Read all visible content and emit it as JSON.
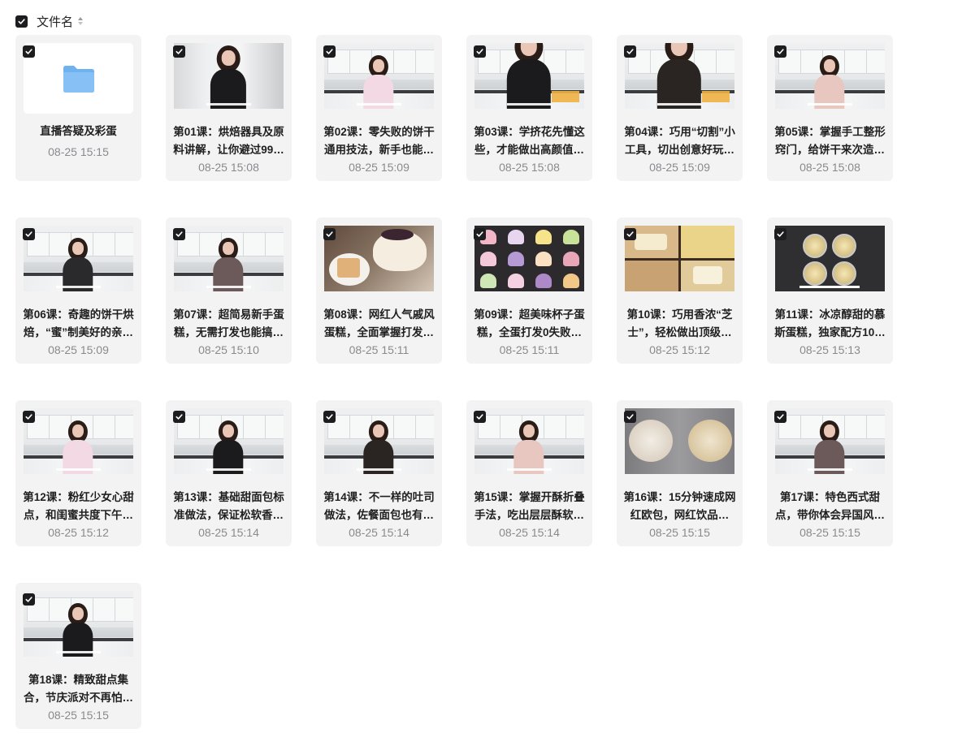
{
  "header": {
    "label": "文件名",
    "sort_icon": "sort-updown-icon",
    "check_icon": "check-icon"
  },
  "colors": {
    "checkbox": "#1d1d1f",
    "card_bg": "#f3f3f4",
    "time": "#8a8a8e",
    "folder": "#6fb2f0"
  },
  "items": [
    {
      "type": "folder",
      "title": "直播答疑及彩蛋",
      "time": "08-25 15:15",
      "icon": "folder-icon"
    },
    {
      "type": "video",
      "title": "第01课：烘焙器具及原料讲解，让你避过99…",
      "time": "08-25 15:08",
      "scene": "studio"
    },
    {
      "type": "video",
      "title": "第02课：零失败的饼干通用技法，新手也能…",
      "time": "08-25 15:09",
      "scene": "kitchen"
    },
    {
      "type": "video",
      "title": "第03课：学挤花先懂这些，才能做出高颜值…",
      "time": "08-25 15:08",
      "scene": "kitchen-close"
    },
    {
      "type": "video",
      "title": "第04课：巧用“切割”小工具，切出创意好玩…",
      "time": "08-25 15:09",
      "scene": "kitchen-close"
    },
    {
      "type": "video",
      "title": "第05课：掌握手工整形窍门，给饼干来次造…",
      "time": "08-25 15:08",
      "scene": "kitchen"
    },
    {
      "type": "video",
      "title": "第06课：奇趣的饼干烘焙，“蜜”制美好的亲…",
      "time": "08-25 15:09",
      "scene": "kitchen"
    },
    {
      "type": "video",
      "title": "第07课：超简易新手蛋糕，无需打发也能搞…",
      "time": "08-25 15:10",
      "scene": "kitchen"
    },
    {
      "type": "video",
      "title": "第08课：网红人气戚风蛋糕，全面掌握打发…",
      "time": "08-25 15:11",
      "scene": "cake"
    },
    {
      "type": "video",
      "title": "第09课：超美味杯子蛋糕，全蛋打发0失败…",
      "time": "08-25 15:11",
      "scene": "cupcakes"
    },
    {
      "type": "video",
      "title": "第10课：巧用香浓“芝士”，轻松做出顶级…",
      "time": "08-25 15:12",
      "scene": "cheese"
    },
    {
      "type": "video",
      "title": "第11课：冰凉醇甜的慕斯蛋糕，独家配方10…",
      "time": "08-25 15:13",
      "scene": "mousse"
    },
    {
      "type": "video",
      "title": "第12课：粉红少女心甜点，和闺蜜共度下午…",
      "time": "08-25 15:12",
      "scene": "kitchen"
    },
    {
      "type": "video",
      "title": "第13课：基础甜面包标准做法，保证松软香…",
      "time": "08-25 15:14",
      "scene": "kitchen"
    },
    {
      "type": "video",
      "title": "第14课：不一样的吐司做法，佐餐面包也有…",
      "time": "08-25 15:14",
      "scene": "kitchen"
    },
    {
      "type": "video",
      "title": "第15课：掌握开酥折叠手法，吃出层层酥软…",
      "time": "08-25 15:14",
      "scene": "kitchen"
    },
    {
      "type": "video",
      "title": "第16课：15分钟速成网红欧包，网红饮品…",
      "time": "08-25 15:15",
      "scene": "bread"
    },
    {
      "type": "video",
      "title": "第17课：特色西式甜点，带你体会异国风…",
      "time": "08-25 15:15",
      "scene": "kitchen"
    },
    {
      "type": "video",
      "title": "第18课：精致甜点集合，节庆派对不再怕…",
      "time": "08-25 15:15",
      "scene": "kitchen"
    }
  ]
}
